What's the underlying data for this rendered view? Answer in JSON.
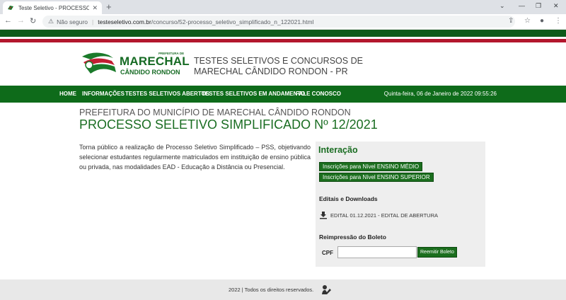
{
  "browser": {
    "tab_title": "Teste Seletivo - PROCESSO SELETIV",
    "tab_close": "✕",
    "new_tab": "+",
    "security_label": "Não seguro",
    "url_host": "testeseletivo.com.br",
    "url_path": "/concurso/52-processo_seletivo_simplificado_n_122021.html"
  },
  "header": {
    "logo_small": "PREFEITURA DE",
    "logo_big": "MARECHAL",
    "logo_sub": "CÂNDIDO RONDON",
    "site_title_line1": "TESTES SELETIVOS E CONCURSOS DE",
    "site_title_line2": "MARECHAL CÂNDIDO RONDON - PR"
  },
  "nav": {
    "items": [
      "HOME",
      "INFORMAÇÕES",
      "TESTES SELETIVOS ABERTOS",
      "TESTES SELETIVOS EM ANDAMENTO",
      "FALE CONOSCO"
    ],
    "datetime": "Quinta-feira, 06 de Janeiro de 2022 09:55:26"
  },
  "main": {
    "pre_title": "PREFEITURA DO MUNICÍPIO DE MARECHAL CÂNDIDO RONDON",
    "title": "PROCESSO SELETIVO SIMPLIFICADO Nº 12/2021",
    "description": "Torna público a realização de Processo Seletivo Simplificado – PSS, objetivando selecionar estudantes regularmente matriculados em instituição de ensino pública ou privada, nas modalidades EAD - Educação a Distância ou Presencial."
  },
  "panel": {
    "title": "Interação",
    "btn_medio": "Inscrições para Nível ENSINO MÉDIO",
    "btn_superior": "Inscrições para Nível ENSINO SUPERIOR",
    "downloads_title": "Editais e Downloads",
    "download_item": "EDITAL 01.12.2021 - EDITAL DE ABERTURA",
    "reprint_title": "Reimpressão do Boleto",
    "cpf_label": "CPF",
    "cpf_value": "",
    "reprint_button": "Reemitir Boleto"
  },
  "footer": {
    "text": "2022 | Todos os direitos reservados."
  },
  "colors": {
    "brand_green": "#0e6b1a",
    "brand_red": "#b3162d"
  }
}
